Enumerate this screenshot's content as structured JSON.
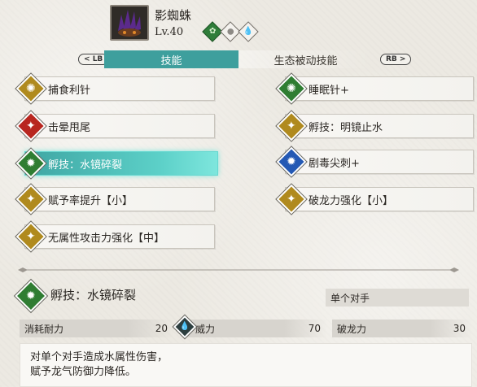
{
  "monster": {
    "name": "影蜘蛛",
    "level": "Lv.40",
    "portrait_icon": "spider-monster-portrait",
    "elements": [
      {
        "icon": "leaf-icon",
        "glyph": "✿"
      },
      {
        "icon": "neutral-icon",
        "glyph": "●"
      },
      {
        "icon": "water-drop-icon",
        "glyph": "💧"
      }
    ]
  },
  "tabs": {
    "lb": "LB",
    "rb": "RB",
    "items": [
      {
        "label": "技能"
      },
      {
        "label": "生态被动技能"
      }
    ]
  },
  "skills": {
    "left": [
      {
        "label": "捕食利针",
        "color": "#b08a1e",
        "glyph": "✺"
      },
      {
        "label": "击晕甩尾",
        "color": "#b8261f",
        "glyph": "✦"
      },
      {
        "label": "孵技：水镜碎裂",
        "color": "#2f7d32",
        "glyph": "✹"
      },
      {
        "label": "赋予率提升【小】",
        "color": "#b08a1e",
        "glyph": "✦"
      },
      {
        "label": "无属性攻击力强化【中】",
        "color": "#b08a1e",
        "glyph": "✦"
      }
    ],
    "right": [
      {
        "label": "睡眠针+",
        "color": "#2f7d32",
        "glyph": "✺"
      },
      {
        "label": "孵技：明镜止水",
        "color": "#b08a1e",
        "glyph": "✦"
      },
      {
        "label": "剧毒尖刺+",
        "color": "#2459b4",
        "glyph": "✹"
      },
      {
        "label": "破龙力强化【小】",
        "color": "#b08a1e",
        "glyph": "✦"
      }
    ]
  },
  "detail": {
    "title": "孵技：水镜碎裂",
    "target": "单个对手",
    "stats": [
      {
        "label": "消耗耐力",
        "value": "20"
      },
      {
        "label": "威力",
        "value": "70"
      },
      {
        "label": "破龙力",
        "value": "30"
      }
    ],
    "description_line1": "对单个对手造成水属性伤害，",
    "description_line2": "赋予龙气防御力降低。"
  }
}
